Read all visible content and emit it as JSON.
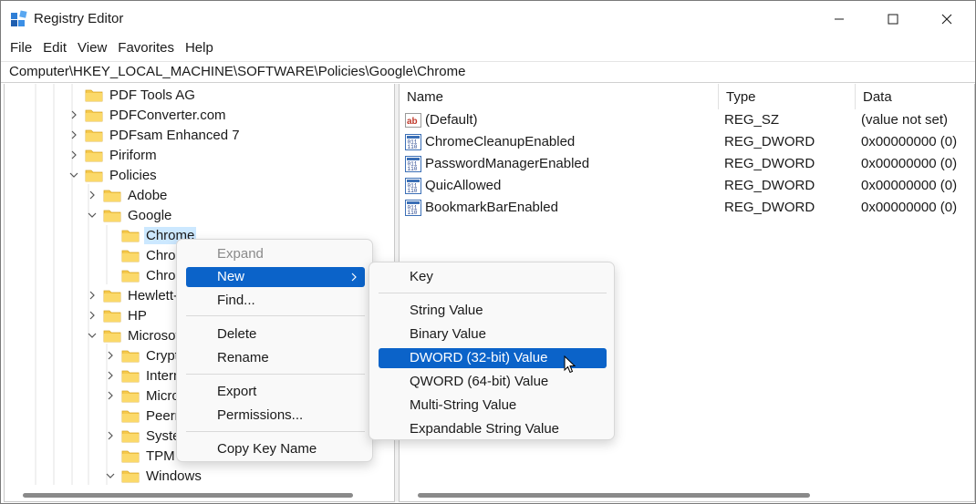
{
  "window": {
    "title": "Registry Editor",
    "icon": "registry-icon",
    "controls": [
      "minimize-icon",
      "maximize-icon",
      "close-icon"
    ]
  },
  "menubar": [
    "File",
    "Edit",
    "View",
    "Favorites",
    "Help"
  ],
  "address": "Computer\\HKEY_LOCAL_MACHINE\\SOFTWARE\\Policies\\Google\\Chrome",
  "tree": [
    {
      "label": "PDF Tools AG",
      "level": 0,
      "expander": "none"
    },
    {
      "label": "PDFConverter.com",
      "level": 0,
      "expander": "collapsed"
    },
    {
      "label": "PDFsam Enhanced 7",
      "level": 0,
      "expander": "collapsed"
    },
    {
      "label": "Piriform",
      "level": 0,
      "expander": "collapsed"
    },
    {
      "label": "Policies",
      "level": 0,
      "expander": "expanded"
    },
    {
      "label": "Adobe",
      "level": 1,
      "expander": "collapsed"
    },
    {
      "label": "Google",
      "level": 1,
      "expander": "expanded"
    },
    {
      "label": "Chrome",
      "level": 2,
      "expander": "none",
      "selected": true
    },
    {
      "label": "Chrom",
      "level": 2,
      "expander": "none"
    },
    {
      "label": "Chrom",
      "level": 2,
      "expander": "none"
    },
    {
      "label": "Hewlett-",
      "level": 1,
      "expander": "collapsed"
    },
    {
      "label": "HP",
      "level": 1,
      "expander": "collapsed"
    },
    {
      "label": "Microsof",
      "level": 1,
      "expander": "expanded"
    },
    {
      "label": "Crypto",
      "level": 2,
      "expander": "collapsed"
    },
    {
      "label": "Intern",
      "level": 2,
      "expander": "collapsed"
    },
    {
      "label": "Micro",
      "level": 2,
      "expander": "collapsed"
    },
    {
      "label": "Peern",
      "level": 2,
      "expander": "none"
    },
    {
      "label": "Syster",
      "level": 2,
      "expander": "collapsed"
    },
    {
      "label": "TPM",
      "level": 2,
      "expander": "none"
    },
    {
      "label": "Windows",
      "level": 2,
      "expander": "expanded"
    }
  ],
  "list": {
    "columns": [
      "Name",
      "Type",
      "Data"
    ],
    "rows": [
      {
        "icon": "string-value-icon",
        "name": "(Default)",
        "type": "REG_SZ",
        "data": "(value not set)"
      },
      {
        "icon": "binary-value-icon",
        "name": "ChromeCleanupEnabled",
        "type": "REG_DWORD",
        "data": "0x00000000 (0)"
      },
      {
        "icon": "binary-value-icon",
        "name": "PasswordManagerEnabled",
        "type": "REG_DWORD",
        "data": "0x00000000 (0)"
      },
      {
        "icon": "binary-value-icon",
        "name": "QuicAllowed",
        "type": "REG_DWORD",
        "data": "0x00000000 (0)"
      },
      {
        "icon": "binary-value-icon",
        "name": "BookmarkBarEnabled",
        "type": "REG_DWORD",
        "data": "0x00000000 (0)"
      }
    ]
  },
  "context_menu": {
    "items": [
      {
        "label": "Expand",
        "disabled": true
      },
      {
        "label": "New",
        "highlighted": true,
        "submenu": true
      },
      {
        "label": "Find..."
      },
      {
        "label": "Delete"
      },
      {
        "label": "Rename"
      },
      {
        "label": "Export"
      },
      {
        "label": "Permissions..."
      },
      {
        "label": "Copy Key Name"
      }
    ]
  },
  "submenu": {
    "items": [
      {
        "label": "Key"
      },
      {
        "label": "String Value"
      },
      {
        "label": "Binary Value"
      },
      {
        "label": "DWORD (32-bit) Value",
        "highlighted": true
      },
      {
        "label": "QWORD (64-bit) Value"
      },
      {
        "label": "Multi-String Value"
      },
      {
        "label": "Expandable String Value"
      }
    ]
  },
  "colors": {
    "accent": "#0b63c9",
    "selection": "#cce8ff",
    "folder": "#f6c94c"
  }
}
